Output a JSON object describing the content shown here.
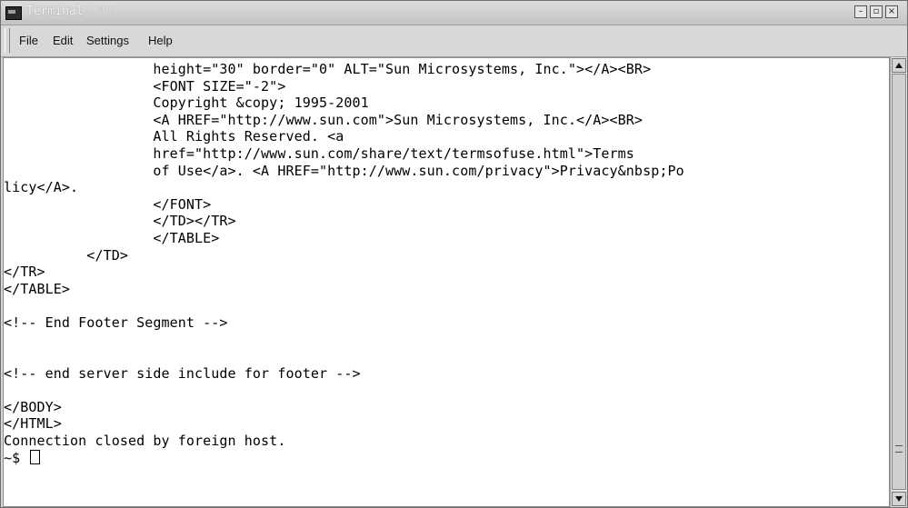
{
  "window": {
    "title": "Terminal",
    "title_decoration": "ᴸ⁹ᴮⁿᵒ"
  },
  "window_controls": {
    "minimize": "–",
    "maximize": "▫",
    "close": "×"
  },
  "menu": {
    "items": [
      "File",
      "Edit",
      "Settings",
      "Help"
    ]
  },
  "terminal": {
    "lines": [
      "                  height=\"30\" border=\"0\" ALT=\"Sun Microsystems, Inc.\"></A><BR>",
      "                  <FONT SIZE=\"-2\">",
      "                  Copyright &copy; 1995-2001",
      "                  <A HREF=\"http://www.sun.com\">Sun Microsystems, Inc.</A><BR>",
      "                  All Rights Reserved. <a",
      "                  href=\"http://www.sun.com/share/text/termsofuse.html\">Terms",
      "                  of Use</a>. <A HREF=\"http://www.sun.com/privacy\">Privacy&nbsp;Po",
      "licy</A>.",
      "                  </FONT>",
      "                  </TD></TR>",
      "                  </TABLE>",
      "          </TD>",
      "</TR>",
      "</TABLE>",
      "",
      "<!-- End Footer Segment -->",
      "",
      "",
      "<!-- end server side include for footer -->",
      "",
      "</BODY>",
      "</HTML>",
      "Connection closed by foreign host."
    ],
    "prompt": "~$ "
  },
  "colors": {
    "terminal_bg": "#ffffff",
    "terminal_fg": "#000000",
    "chrome": "#d6d6d6"
  }
}
